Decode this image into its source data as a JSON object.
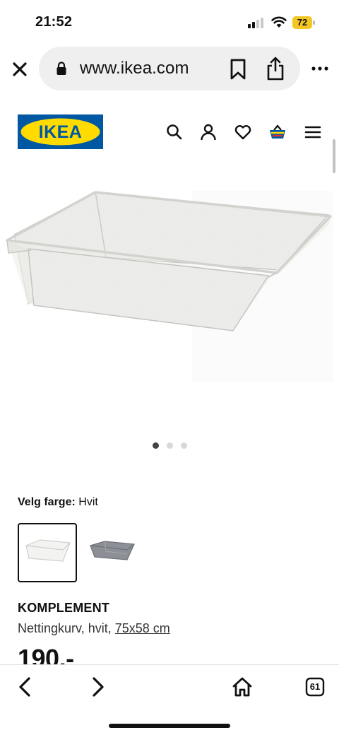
{
  "status_bar": {
    "time": "21:52",
    "battery": "72"
  },
  "browser": {
    "url": "www.ikea.com"
  },
  "header": {
    "logo_text": "IKEA"
  },
  "product": {
    "color_label": "Velg farge:",
    "color_value": "Hvit",
    "name": "KOMPLEMENT",
    "description": "Nettingkurv, hvit,",
    "size": "75x58 cm",
    "price": "190,-"
  },
  "carousel": {
    "count": 3,
    "active": 0
  },
  "toolbar": {
    "tabs_count": "61"
  },
  "colors": {
    "ikea_blue": "#0058a3",
    "ikea_yellow": "#ffdb00",
    "battery": "#f3c623"
  },
  "icons": [
    "close-icon",
    "lock-icon",
    "bookmark-icon",
    "share-icon",
    "more-icon",
    "search-icon",
    "profile-icon",
    "heart-icon",
    "basket-icon",
    "menu-icon",
    "back-icon",
    "forward-icon",
    "home-icon",
    "tabs-icon"
  ]
}
